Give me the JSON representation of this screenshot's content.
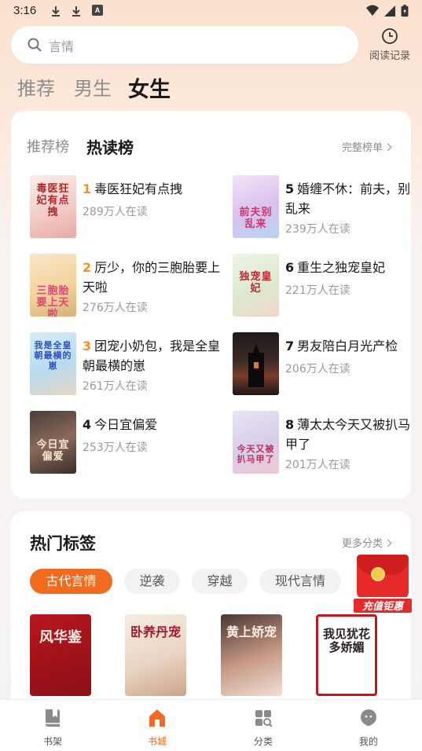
{
  "status_bar": {
    "time": "3:16",
    "notif_a": "A"
  },
  "search": {
    "placeholder": "言情"
  },
  "history": {
    "label": "阅读记录"
  },
  "top_tabs": [
    {
      "label": "推荐"
    },
    {
      "label": "男生"
    },
    {
      "label": "女生",
      "active": true
    }
  ],
  "ranking": {
    "tabs": [
      {
        "label": "推荐榜"
      },
      {
        "label": "热读榜",
        "active": true
      }
    ],
    "more": "完整榜单",
    "books": [
      {
        "rank": "1",
        "title": "毒医狂妃有点拽",
        "readers": "289万人在读",
        "cover_text": "毒医狂妃有点拽"
      },
      {
        "rank": "2",
        "title": "厉少，你的三胞胎要上天啦",
        "readers": "276万人在读",
        "cover_text": "三胞胎要上天啦"
      },
      {
        "rank": "3",
        "title": "团宠小奶包，我是全皇朝最横的崽",
        "readers": "261万人在读",
        "cover_text": "我是全皇朝最横的崽"
      },
      {
        "rank": "4",
        "title": "今日宜偏爱",
        "readers": "253万人在读",
        "cover_text": "今日宜偏爱"
      },
      {
        "rank": "5",
        "title": "婚缠不休：前夫，别乱来",
        "readers": "239万人在读",
        "cover_text": "前夫别乱来"
      },
      {
        "rank": "6",
        "title": "重生之独宠皇妃",
        "readers": "221万人在读",
        "cover_text": "独宠皇妃"
      },
      {
        "rank": "7",
        "title": "男友陪白月光产检",
        "readers": "206万人在读",
        "cover_text": ""
      },
      {
        "rank": "8",
        "title": "薄太太今天又被扒马甲了",
        "readers": "201万人在读",
        "cover_text": "今天又被扒马甲了"
      }
    ]
  },
  "tags": {
    "title": "热门标签",
    "more": "更多分类",
    "chips": [
      {
        "label": "古代言情",
        "active": true
      },
      {
        "label": "逆袭"
      },
      {
        "label": "穿越"
      },
      {
        "label": "现代言情"
      }
    ],
    "books": [
      {
        "cover_text": "风华鉴"
      },
      {
        "cover_text": "卧养丹宠"
      },
      {
        "cover_text": "黄上娇宠"
      },
      {
        "cover_text": "我见犹花多娇媚"
      }
    ]
  },
  "promo": {
    "label": "充值钜惠"
  },
  "bottom_nav": [
    {
      "label": "书架",
      "icon": "bookshelf-icon"
    },
    {
      "label": "书城",
      "icon": "bookstore-icon",
      "active": true
    },
    {
      "label": "分类",
      "icon": "category-icon"
    },
    {
      "label": "我的",
      "icon": "profile-icon"
    }
  ],
  "colors": {
    "accent": "#f36b21",
    "rank_top": "#f0922b",
    "promo_red": "#e62a2a"
  }
}
